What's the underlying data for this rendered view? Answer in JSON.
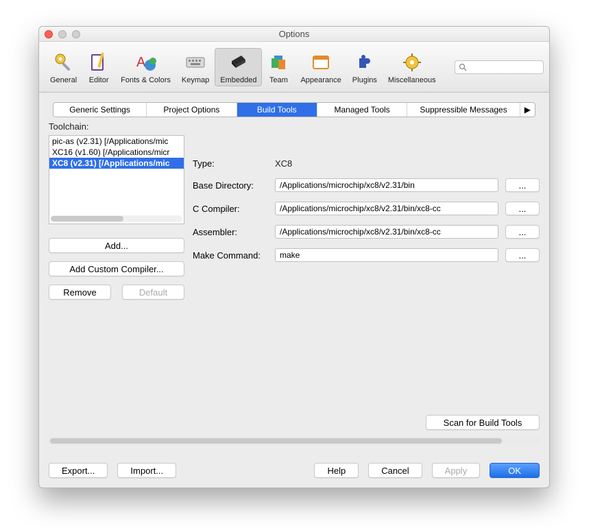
{
  "window": {
    "title": "Options"
  },
  "toolbar": {
    "items": [
      {
        "label": "General"
      },
      {
        "label": "Editor"
      },
      {
        "label": "Fonts & Colors"
      },
      {
        "label": "Keymap"
      },
      {
        "label": "Embedded"
      },
      {
        "label": "Team"
      },
      {
        "label": "Appearance"
      },
      {
        "label": "Plugins"
      },
      {
        "label": "Miscellaneous"
      }
    ],
    "search_placeholder": ""
  },
  "tabs": [
    "Generic Settings",
    "Project Options",
    "Build Tools",
    "Managed Tools",
    "Suppressible Messages"
  ],
  "tabs_arrow": "▶",
  "toolchain": {
    "label": "Toolchain:",
    "items": [
      "pic-as (v2.31) [/Applications/mic",
      "XC16 (v1.60) [/Applications/micr",
      "XC8 (v2.31) [/Applications/mic"
    ],
    "selected_index": 2
  },
  "form": {
    "type_label": "Type:",
    "type_value": "XC8",
    "basedir_label": "Base Directory:",
    "basedir_value": "/Applications/microchip/xc8/v2.31/bin",
    "cc_label": "C Compiler:",
    "cc_value": "/Applications/microchip/xc8/v2.31/bin/xc8-cc",
    "asm_label": "Assembler:",
    "asm_value": "/Applications/microchip/xc8/v2.31/bin/xc8-cc",
    "make_label": "Make Command:",
    "make_value": "make",
    "dots": "..."
  },
  "buttons": {
    "add": "Add...",
    "add_custom": "Add Custom Compiler...",
    "remove": "Remove",
    "default": "Default",
    "scan": "Scan for Build Tools"
  },
  "footer": {
    "export": "Export...",
    "import": "Import...",
    "help": "Help",
    "cancel": "Cancel",
    "apply": "Apply",
    "ok": "OK"
  }
}
